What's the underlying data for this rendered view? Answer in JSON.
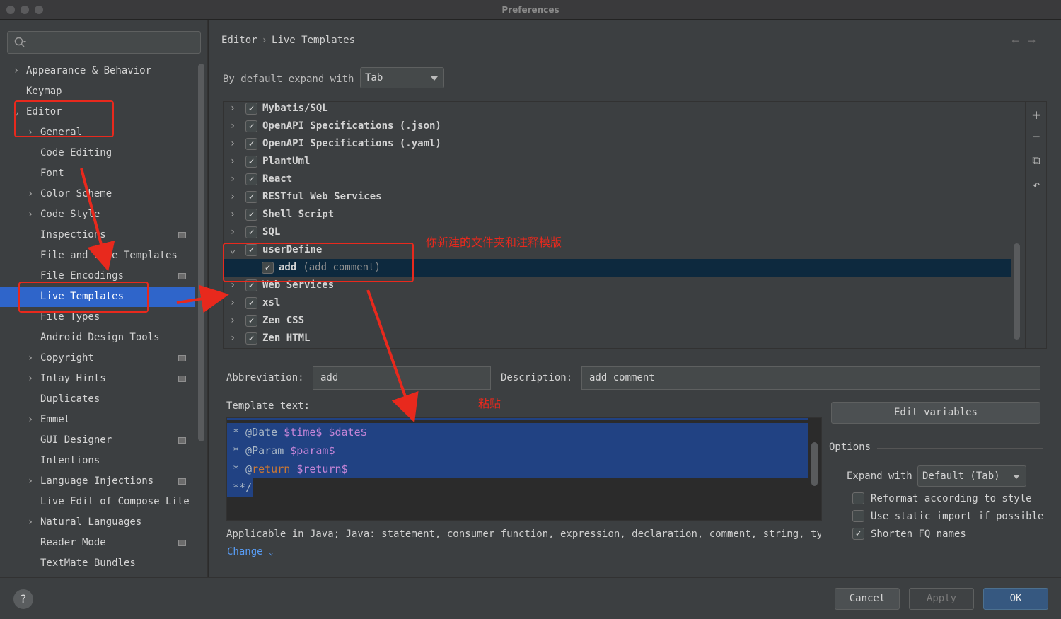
{
  "window": {
    "title": "Preferences"
  },
  "sidebar": {
    "items": [
      {
        "label": "Appearance & Behavior",
        "arrow": "›",
        "expanded": false,
        "proj": false
      },
      {
        "label": "Keymap",
        "arrow": "",
        "expanded": false,
        "proj": false
      },
      {
        "label": "Editor",
        "arrow": "⌄",
        "expanded": true,
        "proj": false
      },
      {
        "label": "General",
        "arrow": "›",
        "expanded": false,
        "proj": false
      },
      {
        "label": "Code Editing",
        "arrow": "",
        "expanded": false,
        "proj": false
      },
      {
        "label": "Font",
        "arrow": "",
        "expanded": false,
        "proj": false
      },
      {
        "label": "Color Scheme",
        "arrow": "›",
        "expanded": false,
        "proj": false
      },
      {
        "label": "Code Style",
        "arrow": "›",
        "expanded": false,
        "proj": false
      },
      {
        "label": "Inspections",
        "arrow": "",
        "expanded": false,
        "proj": true
      },
      {
        "label": "File and Code Templates",
        "arrow": "",
        "expanded": false,
        "proj": false
      },
      {
        "label": "File Encodings",
        "arrow": "",
        "expanded": false,
        "proj": true
      },
      {
        "label": "Live Templates",
        "arrow": "",
        "expanded": false,
        "proj": false,
        "selected": true
      },
      {
        "label": "File Types",
        "arrow": "",
        "expanded": false,
        "proj": false
      },
      {
        "label": "Android Design Tools",
        "arrow": "",
        "expanded": false,
        "proj": false
      },
      {
        "label": "Copyright",
        "arrow": "›",
        "expanded": false,
        "proj": true
      },
      {
        "label": "Inlay Hints",
        "arrow": "›",
        "expanded": false,
        "proj": true
      },
      {
        "label": "Duplicates",
        "arrow": "",
        "expanded": false,
        "proj": false
      },
      {
        "label": "Emmet",
        "arrow": "›",
        "expanded": false,
        "proj": false
      },
      {
        "label": "GUI Designer",
        "arrow": "",
        "expanded": false,
        "proj": true
      },
      {
        "label": "Intentions",
        "arrow": "",
        "expanded": false,
        "proj": false
      },
      {
        "label": "Language Injections",
        "arrow": "›",
        "expanded": false,
        "proj": true
      },
      {
        "label": "Live Edit of Compose Lite",
        "arrow": "",
        "expanded": false,
        "proj": false
      },
      {
        "label": "Natural Languages",
        "arrow": "›",
        "expanded": false,
        "proj": false
      },
      {
        "label": "Reader Mode",
        "arrow": "",
        "expanded": false,
        "proj": true
      },
      {
        "label": "TextMate Bundles",
        "arrow": "",
        "expanded": false,
        "proj": false
      }
    ]
  },
  "breadcrumb": {
    "parent": "Editor",
    "separator": "›",
    "current": "Live Templates"
  },
  "nav": {
    "back": "←",
    "forward": "→"
  },
  "expand_default": {
    "label": "By default expand with",
    "value": "Tab"
  },
  "templates": [
    {
      "name": "Mybatis/SQL",
      "checked": true,
      "expanded": false
    },
    {
      "name": "OpenAPI Specifications (.json)",
      "checked": true,
      "expanded": false
    },
    {
      "name": "OpenAPI Specifications (.yaml)",
      "checked": true,
      "expanded": false
    },
    {
      "name": "PlantUml",
      "checked": true,
      "expanded": false
    },
    {
      "name": "React",
      "checked": true,
      "expanded": false
    },
    {
      "name": "RESTful Web Services",
      "checked": true,
      "expanded": false
    },
    {
      "name": "Shell Script",
      "checked": true,
      "expanded": false
    },
    {
      "name": "SQL",
      "checked": true,
      "expanded": false
    },
    {
      "name": "userDefine",
      "checked": true,
      "expanded": true
    },
    {
      "name": "add",
      "desc": "(add comment)",
      "checked": true,
      "child": true,
      "selected": true
    },
    {
      "name": "Web Services",
      "checked": true,
      "expanded": false
    },
    {
      "name": "xsl",
      "checked": true,
      "expanded": false
    },
    {
      "name": "Zen CSS",
      "checked": true,
      "expanded": false
    },
    {
      "name": "Zen HTML",
      "checked": true,
      "expanded": false
    }
  ],
  "toolbar": {
    "add": "+",
    "remove": "−",
    "copy": "⧉",
    "restore": "↶"
  },
  "abbreviation": {
    "label": "Abbreviation:",
    "value": "add"
  },
  "description": {
    "label": "Description:",
    "value": "add comment"
  },
  "template_text": {
    "label": "Template text:",
    "lines": [
      {
        "pre": "* @Date ",
        "var1": "$time$",
        "mid": " ",
        "var2": "$date$",
        "hl": true
      },
      {
        "pre": "* @Param ",
        "var1": "$param$",
        "hl": true
      },
      {
        "pre": "* @",
        "kw": "return",
        "mid": " ",
        "var2": "$return$",
        "hl": true
      },
      {
        "pre": "**/",
        "hl": true,
        "partial": true
      }
    ]
  },
  "edit_variables": "Edit variables",
  "options": {
    "title": "Options",
    "expand_label": "Expand with",
    "expand_value": "Default (Tab)",
    "checkboxes": [
      {
        "label": "Reformat according to style",
        "checked": false
      },
      {
        "label": "Use static import if possible",
        "checked": false
      },
      {
        "label": "Shorten FQ names",
        "checked": true
      }
    ]
  },
  "applicable": "Applicable in Java; Java: statement, consumer function, expression, declaration, comment, string, ty",
  "change": "Change",
  "footer": {
    "help": "?",
    "cancel": "Cancel",
    "apply": "Apply",
    "ok": "OK"
  },
  "annotations": {
    "folder_note": "你新建的文件夹和注释模版",
    "paste_note": "粘贴",
    "color": "#e8291d"
  }
}
